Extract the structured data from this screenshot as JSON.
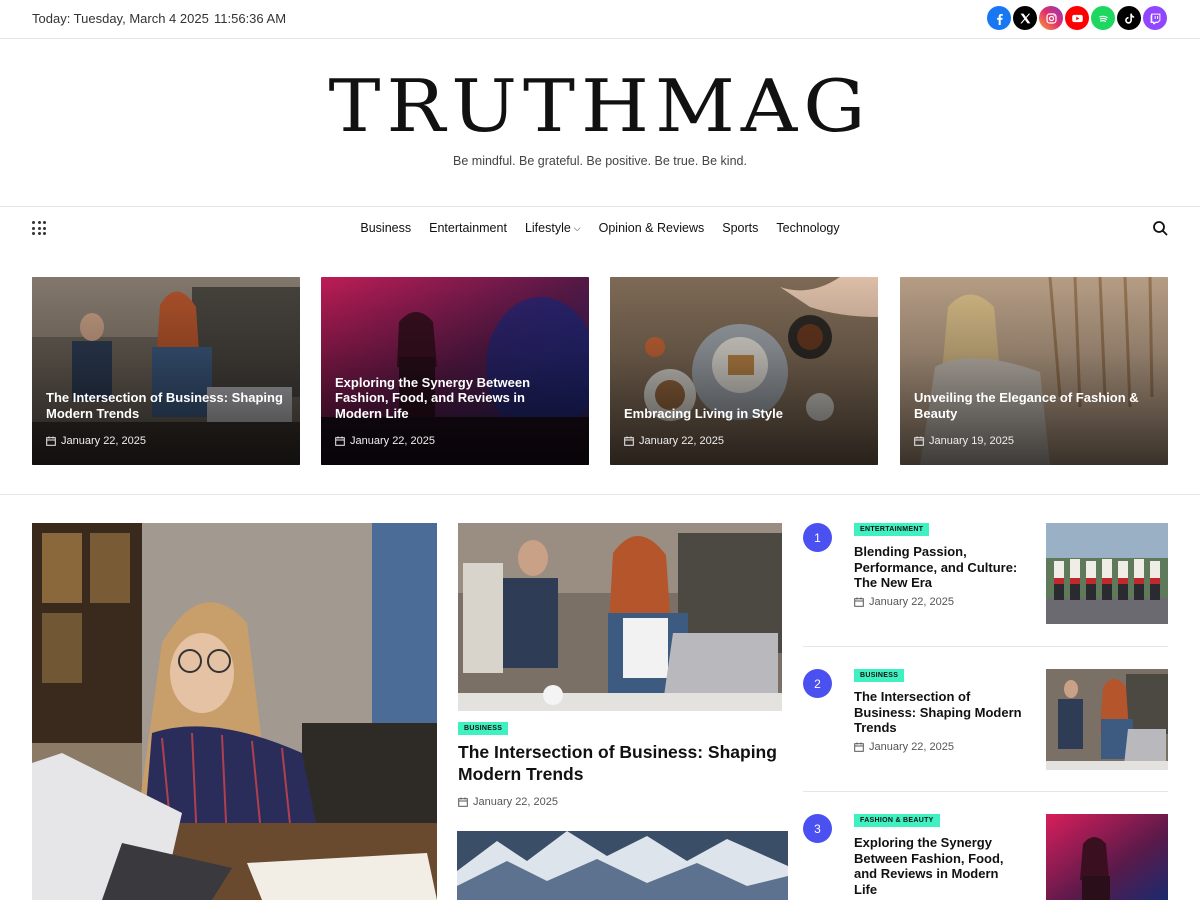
{
  "topbar": {
    "date": "Today: Tuesday, March 4 2025",
    "time": "11:56:36 AM",
    "social": [
      {
        "name": "facebook-icon",
        "color": "#1877f2"
      },
      {
        "name": "x-icon",
        "color": "#000000"
      },
      {
        "name": "instagram-icon",
        "color": "#e1306c"
      },
      {
        "name": "youtube-icon",
        "color": "#ff0000"
      },
      {
        "name": "spotify-icon",
        "color": "#1ed760"
      },
      {
        "name": "tiktok-icon",
        "color": "#000000"
      },
      {
        "name": "twitch-icon",
        "color": "#9146ff"
      }
    ]
  },
  "brand": {
    "logo": "TRUTHMAG",
    "tagline": "Be mindful. Be grateful. Be positive. Be true. Be kind."
  },
  "nav": {
    "items": [
      "Business",
      "Entertainment",
      "Lifestyle",
      "Opinion & Reviews",
      "Sports",
      "Technology"
    ]
  },
  "featured": [
    {
      "title": "The Intersection of Business: Shaping Modern Trends",
      "date": "January 22, 2025"
    },
    {
      "title": "Exploring the Synergy Between Fashion, Food, and Reviews in Modern Life",
      "date": "January 22, 2025"
    },
    {
      "title": "Embracing Living in Style",
      "date": "January 22, 2025"
    },
    {
      "title": "Unveiling the Elegance of Fashion & Beauty",
      "date": "January 19, 2025"
    }
  ],
  "center": {
    "badge": "BUSINESS",
    "title": "The Intersection of Business: Shaping Modern Trends",
    "date": "January 22, 2025"
  },
  "ranked": [
    {
      "rank": "1",
      "badge": "ENTERTAINMENT",
      "title": "Blending Passion, Performance, and Culture: The New Era",
      "date": "January 22, 2025"
    },
    {
      "rank": "2",
      "badge": "BUSINESS",
      "title": "The Intersection of Business: Shaping Modern Trends",
      "date": "January 22, 2025"
    },
    {
      "rank": "3",
      "badge": "FASHION & BEAUTY",
      "title": "Exploring the Synergy Between Fashion, Food, and Reviews in Modern Life",
      "date": ""
    }
  ],
  "colors": {
    "badge": "#3ff0c0",
    "rank": "#4b50f0"
  }
}
